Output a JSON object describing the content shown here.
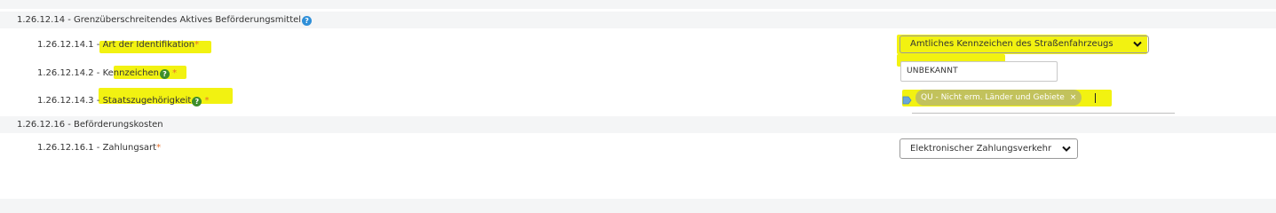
{
  "sections": [
    {
      "title": "1.26.12.14 - Grenzüberschreitendes Aktives Beförderungsmittel",
      "help": "?",
      "fields": [
        {
          "label": "1.26.12.14.1 - Art der Identifikation",
          "required": "*",
          "value": "Amtliches Kennzeichen des Straßenfahrzeugs"
        },
        {
          "label": "1.26.12.14.2 - Kennzeichen",
          "help": "?",
          "required": "*",
          "value": "UNBEKANNT"
        },
        {
          "label": "1.26.12.14.3 - Staatszugehörigkeit",
          "help": "?",
          "required": "*",
          "chip_label": "QU - Nicht erm. Länder und Gebiete",
          "chip_remove": "×"
        }
      ]
    },
    {
      "title": "1.26.12.16 - Beförderungskosten",
      "fields": [
        {
          "label": "1.26.12.16.1 - Zahlungsart",
          "required": "*",
          "value": "Elektronischer Zahlungsverkehr"
        }
      ]
    }
  ],
  "icons": {
    "help": "help-icon",
    "dropdown": "chevron-down-icon",
    "tag": "tag-icon",
    "remove": "close-icon"
  },
  "colors": {
    "highlight": "#f2f211",
    "required": "#e8702a",
    "help_blue": "#2f8fd8",
    "help_green": "#3e8e2b",
    "chip": "#9a9a9a"
  }
}
